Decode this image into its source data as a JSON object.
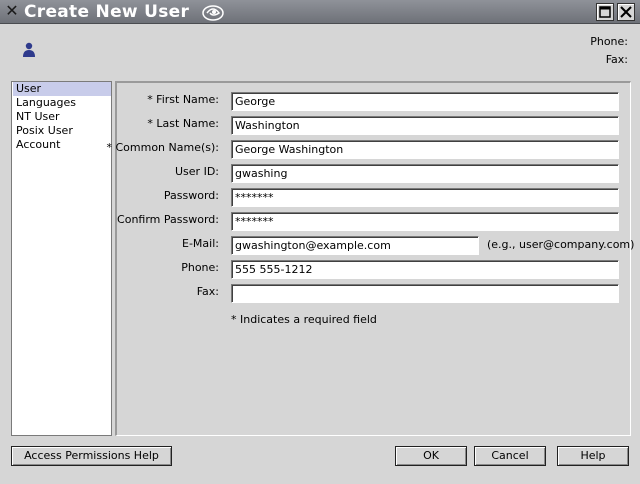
{
  "window": {
    "title": "Create New User",
    "sys_icon": "x-window-icon",
    "logo_icon": "swirl-logo-icon"
  },
  "header": {
    "phone_label": "Phone:",
    "fax_label": "Fax:"
  },
  "sidebar": {
    "items": [
      {
        "label": "User",
        "selected": true
      },
      {
        "label": "Languages",
        "selected": false
      },
      {
        "label": "NT User",
        "selected": false
      },
      {
        "label": "Posix User",
        "selected": false
      },
      {
        "label": "Account",
        "selected": false
      }
    ]
  },
  "form": {
    "first_name": {
      "label": "* First Name:",
      "value": "George"
    },
    "last_name": {
      "label": "* Last Name:",
      "value": "Washington"
    },
    "common_name": {
      "label": "* Common Name(s):",
      "value": "George Washington"
    },
    "user_id": {
      "label": "User ID:",
      "value": "gwashing"
    },
    "password": {
      "label": "Password:",
      "value": "*******"
    },
    "confirm_password": {
      "label": "Confirm Password:",
      "value": "*******"
    },
    "email": {
      "label": "E-Mail:",
      "value": "gwashington@example.com",
      "hint": "(e.g., user@company.com)"
    },
    "phone": {
      "label": "Phone:",
      "value": "555 555-1212"
    },
    "fax": {
      "label": "Fax:",
      "value": ""
    },
    "required_note": "* Indicates a required field"
  },
  "buttons": {
    "access_help": "Access Permissions Help",
    "ok": "OK",
    "cancel": "Cancel",
    "help": "Help"
  },
  "colors": {
    "titlebar": "#7f8289",
    "selection": "#c8ccea",
    "background": "#d6d6d6"
  }
}
